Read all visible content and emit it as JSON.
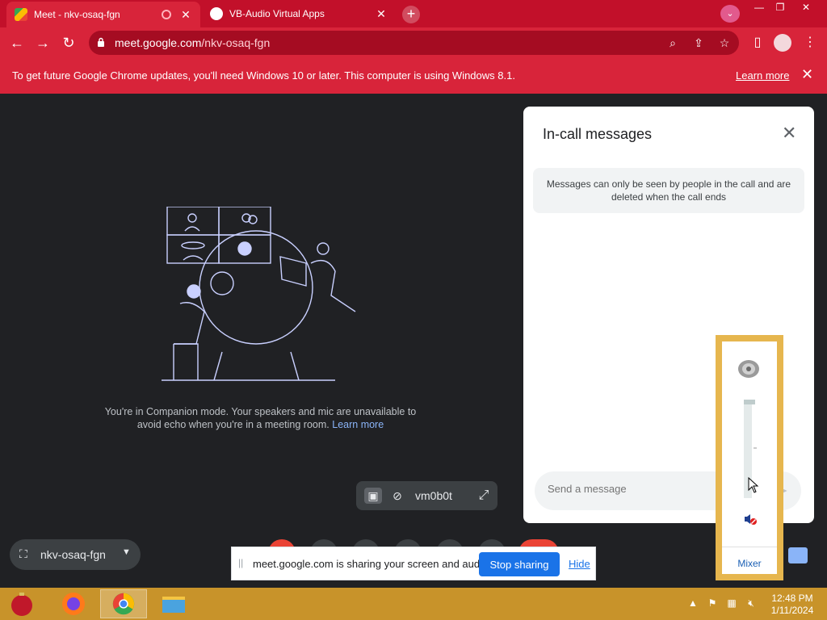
{
  "browser": {
    "tabs": [
      {
        "title": "Meet - nkv-osaq-fgn",
        "active": true
      },
      {
        "title": "VB-Audio Virtual Apps",
        "active": false
      }
    ],
    "url_domain": "meet.google.com",
    "url_path": "/nkv-osaq-fgn"
  },
  "infobar": {
    "message": "To get future Google Chrome updates, you'll need Windows 10 or later. This computer is using Windows 8.1.",
    "learn_more": "Learn more"
  },
  "stage": {
    "companion_text": "You're in Companion mode. Your speakers and mic are unavailable to avoid echo when you're in a meeting room.",
    "companion_link": "Learn more",
    "self_name": "vm0b0t"
  },
  "chat": {
    "title": "In-call messages",
    "notice": "Messages can only be seen by people in the call and are deleted when the call ends",
    "placeholder": "Send a message"
  },
  "meeting": {
    "code": "nkv-osaq-fgn"
  },
  "share": {
    "message": "meet.google.com is sharing your screen and audio.",
    "stop": "Stop sharing",
    "hide": "Hide"
  },
  "mixer": {
    "label": "Mixer",
    "volume_level": 0.0,
    "muted": true
  },
  "taskbar": {
    "time": "12:48 PM",
    "date": "1/11/2024"
  },
  "colors": {
    "chrome_red": "#d8243a",
    "meet_bg": "#202124",
    "taskbar": "#c8932a",
    "link_blue": "#8ab4f8",
    "button_blue": "#1a73e8"
  }
}
